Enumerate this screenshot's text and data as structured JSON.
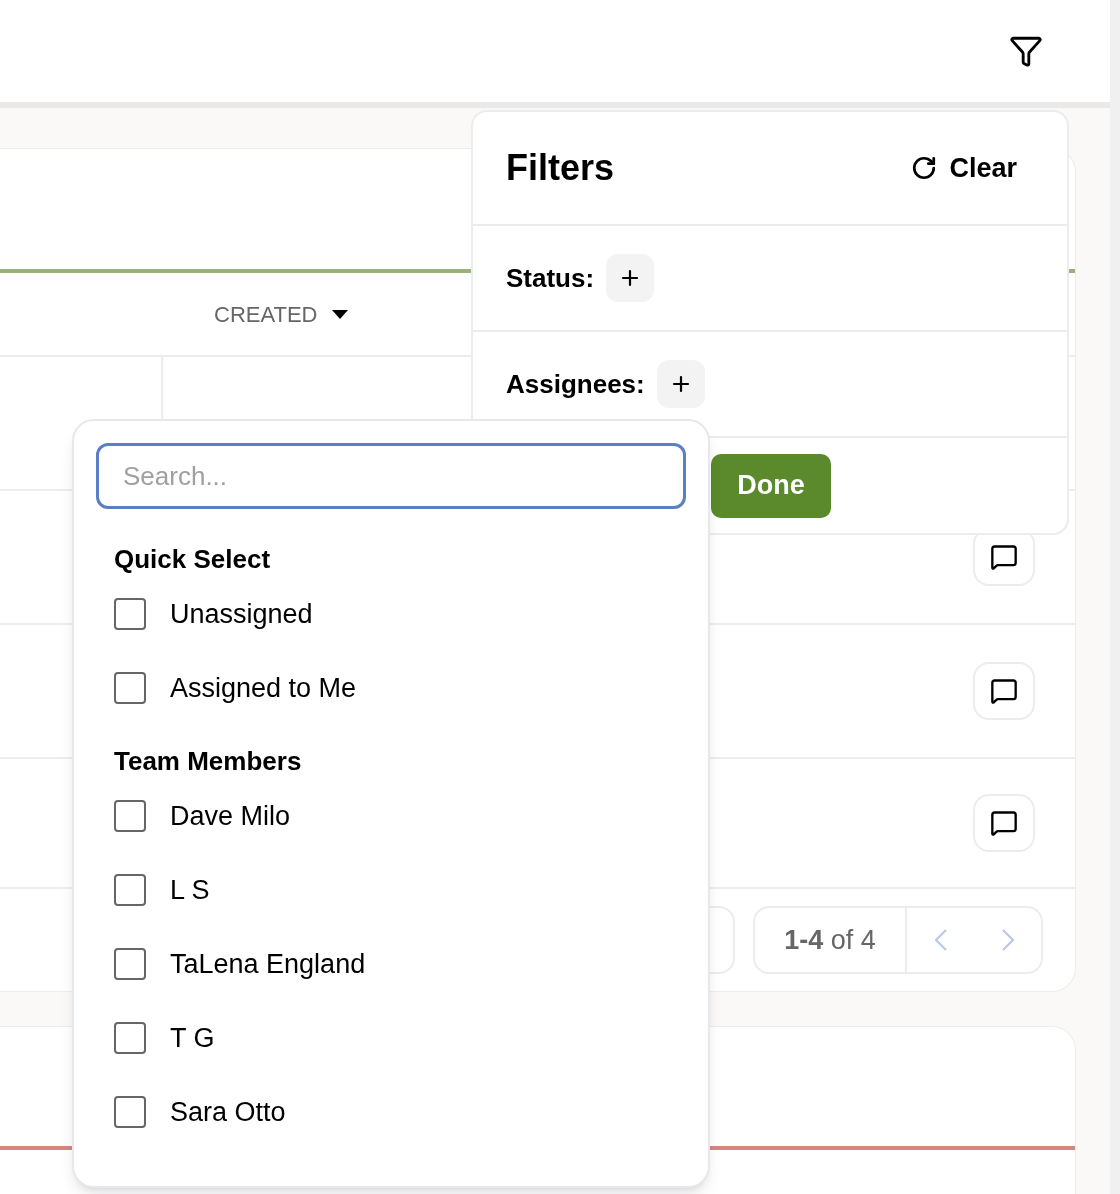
{
  "table": {
    "columns": [
      {
        "label": "CREATED",
        "sorted": true,
        "descending": true
      }
    ],
    "rows": [
      {
        "kind": "comment"
      },
      {
        "kind": "comment"
      },
      {
        "kind": "comment"
      }
    ],
    "pagination": {
      "range": "**1-4** of 4",
      "prev": {
        "disabled": true
      },
      "next": {
        "disabled": true
      }
    }
  },
  "filters": {
    "title": "Filters",
    "clear": "Clear",
    "groups": [
      {
        "label": "Status:"
      },
      {
        "label": "Assignees:"
      }
    ],
    "done": "Done"
  },
  "assignee_menu": {
    "search": {
      "placeholder": "Search..."
    },
    "sections": [
      {
        "heading": "Quick Select",
        "options": [
          {
            "label": "Unassigned",
            "checked": false
          },
          {
            "label": "Assigned to Me",
            "checked": false
          }
        ]
      },
      {
        "heading": "Team Members",
        "options": [
          {
            "label": "Dave Milo",
            "checked": false
          },
          {
            "label": "L S",
            "checked": false
          },
          {
            "label": "TaLena England",
            "checked": false
          },
          {
            "label": "T G",
            "checked": false
          },
          {
            "label": "Sara Otto",
            "checked": false
          }
        ]
      }
    ]
  }
}
